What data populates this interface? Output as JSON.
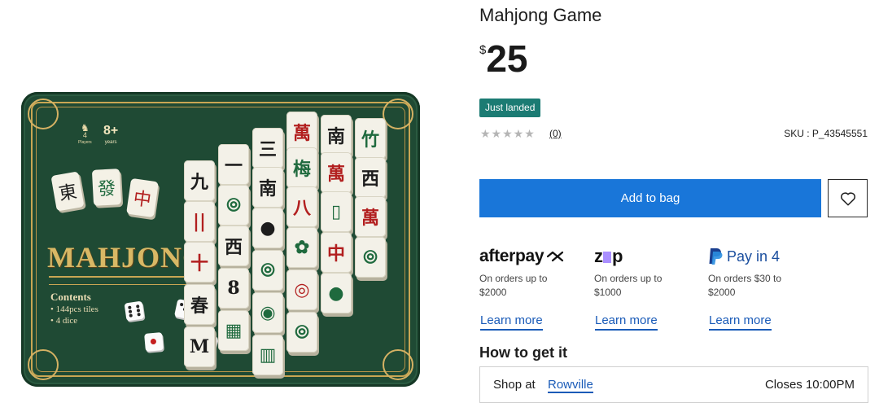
{
  "product": {
    "title": "Mahjong Game",
    "currency": "$",
    "price": "25",
    "badge": "Just landed",
    "rating": {
      "stars": "★★★★★",
      "reviews": "(0)"
    },
    "sku": "SKU : P_43545551"
  },
  "image": {
    "players_num": "4",
    "players_label": "Players",
    "age": "8+",
    "age_label": "years",
    "brand": "MAHJONG",
    "contents_heading": "Contents",
    "contents": [
      "• 144pcs tiles",
      "• 4 dice"
    ]
  },
  "actions": {
    "add_to_bag": "Add to bag",
    "wishlist_icon": "heart-icon"
  },
  "payments": [
    {
      "name": "afterpay",
      "logo_text": "afterpay",
      "desc_line1": "On orders up to",
      "desc_line2": "$2000",
      "learn": "Learn more"
    },
    {
      "name": "zip",
      "logo_text": "zip",
      "desc_line1": "On orders up to",
      "desc_line2": "$1000",
      "learn": "Learn more"
    },
    {
      "name": "paypal",
      "logo_text": "Pay in 4",
      "desc_line1": "On orders $30 to",
      "desc_line2": "$2000",
      "learn": "Learn more"
    }
  ],
  "fulfilment": {
    "heading": "How to get it",
    "shop_at": "Shop at",
    "store": "Rowville",
    "closes": "Closes 10:00PM"
  },
  "colors": {
    "accent": "#1976d9",
    "badge": "#1b7b73",
    "link": "#1a5bb8",
    "tin": "#1f4a34",
    "gold": "#c9a653"
  }
}
